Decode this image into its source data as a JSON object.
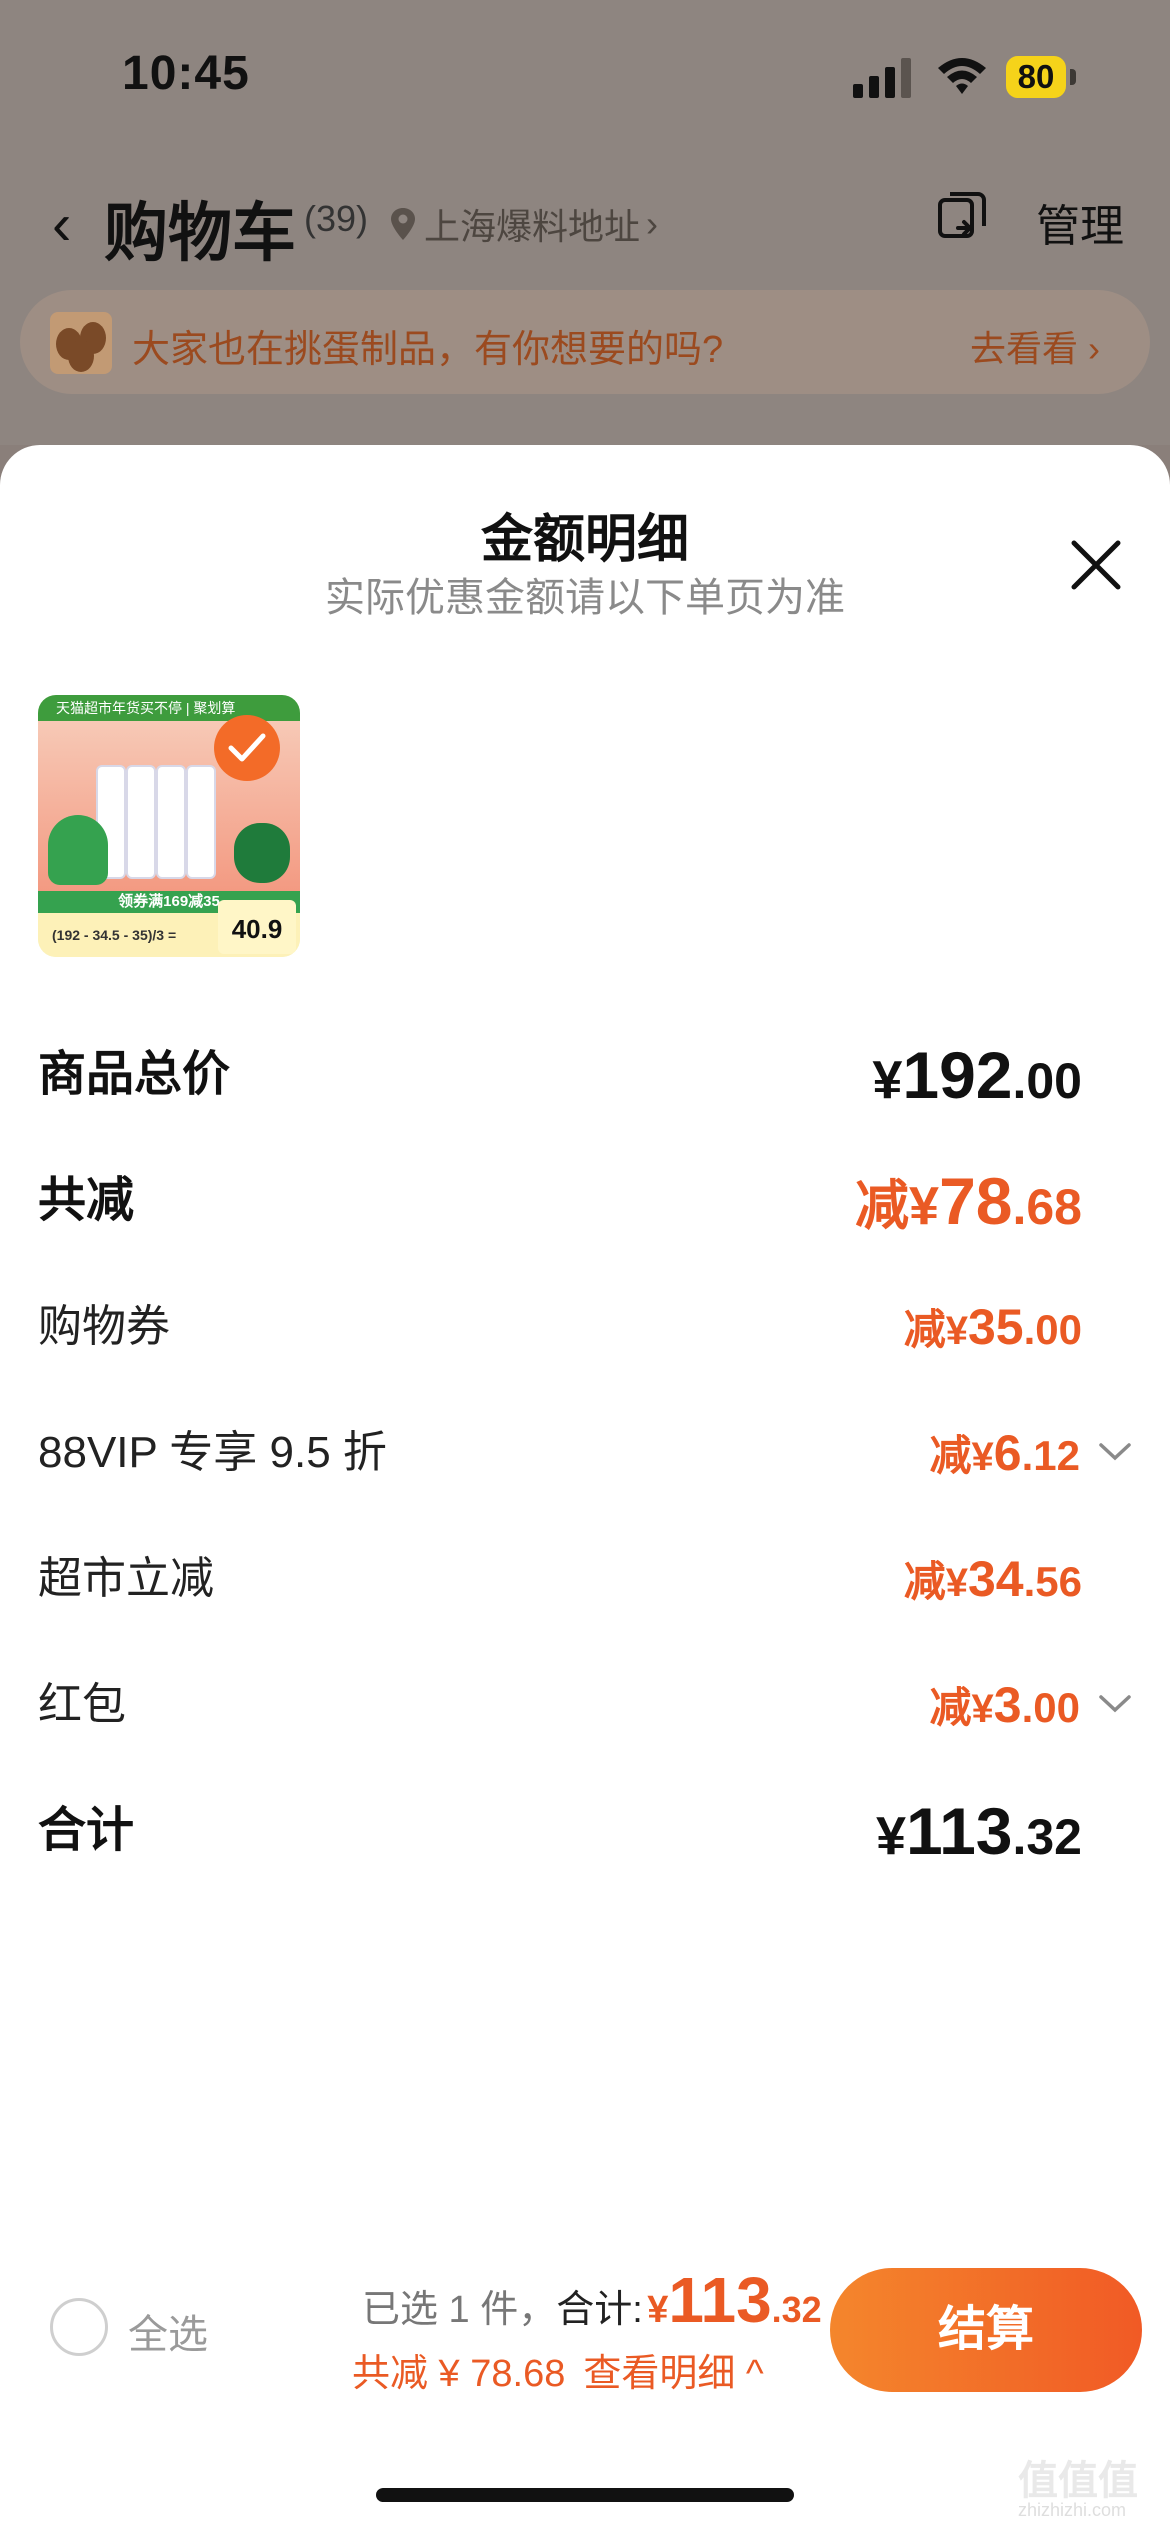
{
  "status_bar": {
    "time": "10:45",
    "battery": "80"
  },
  "nav": {
    "back_icon": "chevron-left-icon",
    "title": "购物车",
    "count": "(39)",
    "location": "上海爆料地址",
    "location_chevron": "›",
    "manage": "管理"
  },
  "banner": {
    "text": "大家也在挑蛋制品，有你想要的吗?",
    "action": "去看看",
    "action_chevron": "›"
  },
  "sheet": {
    "title": "金额明细",
    "subtitle": "实际优惠金额请以下单页为准",
    "product": {
      "promo_text": "天猫超市年货买不停 | 聚划算",
      "coupon_strip": "领券满169减35",
      "formula": "(192 - 34.5 - 35)/3 =",
      "price": "40.9",
      "selected": true
    },
    "rows": [
      {
        "label": "商品总价",
        "prefix": "",
        "yen": "¥",
        "int": "192",
        "dec": ".00",
        "style": "total"
      },
      {
        "label": "共减",
        "prefix": "减",
        "yen": "¥",
        "int": "78",
        "dec": ".68",
        "style": "discount-total"
      },
      {
        "label": "购物券",
        "prefix": "减",
        "yen": "¥",
        "int": "35",
        "dec": ".00",
        "style": "discount"
      },
      {
        "label": "88VIP 专享 9.5 折",
        "prefix": "减",
        "yen": "¥",
        "int": "6",
        "dec": ".12",
        "style": "discount",
        "expandable": true
      },
      {
        "label": "超市立减",
        "prefix": "减",
        "yen": "¥",
        "int": "34",
        "dec": ".56",
        "style": "discount"
      },
      {
        "label": "红包",
        "prefix": "减",
        "yen": "¥",
        "int": "3",
        "dec": ".00",
        "style": "discount",
        "expandable": true
      },
      {
        "label": "合计",
        "prefix": "",
        "yen": "¥",
        "int": "113",
        "dec": ".32",
        "style": "total"
      }
    ]
  },
  "footer": {
    "select_all": "全选",
    "selected_text": "已选 1 件，",
    "total_label": "合计:",
    "total_yen": "¥",
    "total_int": "113",
    "total_dec": ".32",
    "discount_text": "共减 ¥ 78.68",
    "detail_link": "查看明细 ^",
    "checkout": "结算"
  },
  "watermark": {
    "text": "值值值",
    "sub": "zhizhizhi.com"
  },
  "colors": {
    "accent": "#ea5a24",
    "checkout_start": "#f4862c",
    "checkout_end": "#f15a25"
  }
}
